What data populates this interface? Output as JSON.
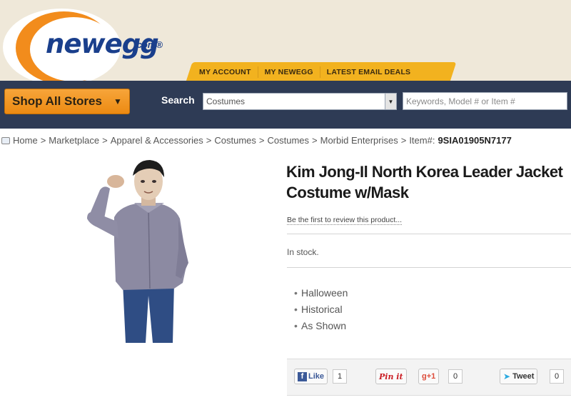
{
  "header": {
    "logo_text": "newegg",
    "logo_suffix": ".com®",
    "tabs": [
      "MY ACCOUNT",
      "MY NEWEGG",
      "LATEST EMAIL DEALS"
    ],
    "shop_all_label": "Shop All Stores",
    "search_label": "Search",
    "category_value": "Costumes",
    "keyword_placeholder": "Keywords, Model # or Item #"
  },
  "breadcrumb": {
    "items": [
      "Home",
      "Marketplace",
      "Apparel & Accessories",
      "Costumes",
      "Costumes",
      "Morbid Enterprises"
    ],
    "item_label": "Item#:",
    "item_number": "9SIA01905N7177"
  },
  "product": {
    "title": "Kim Jong-Il North Korea Leader Jacket Costume w/Mask",
    "review_link": "Be the first to review this product...",
    "stock": "In stock.",
    "features": [
      "Halloween",
      "Historical",
      "As Shown"
    ]
  },
  "social": {
    "like_label": "Like",
    "like_count": "1",
    "pin_label": "Pin it",
    "gplus_label": "+1",
    "gplus_count": "0",
    "tweet_label": "Tweet",
    "tweet_count": "0"
  },
  "colors": {
    "brand_blue": "#1a3f8c",
    "brand_orange": "#f28c1c",
    "nav_dark": "#2e3b55",
    "tab_gold": "#f2b21f"
  }
}
